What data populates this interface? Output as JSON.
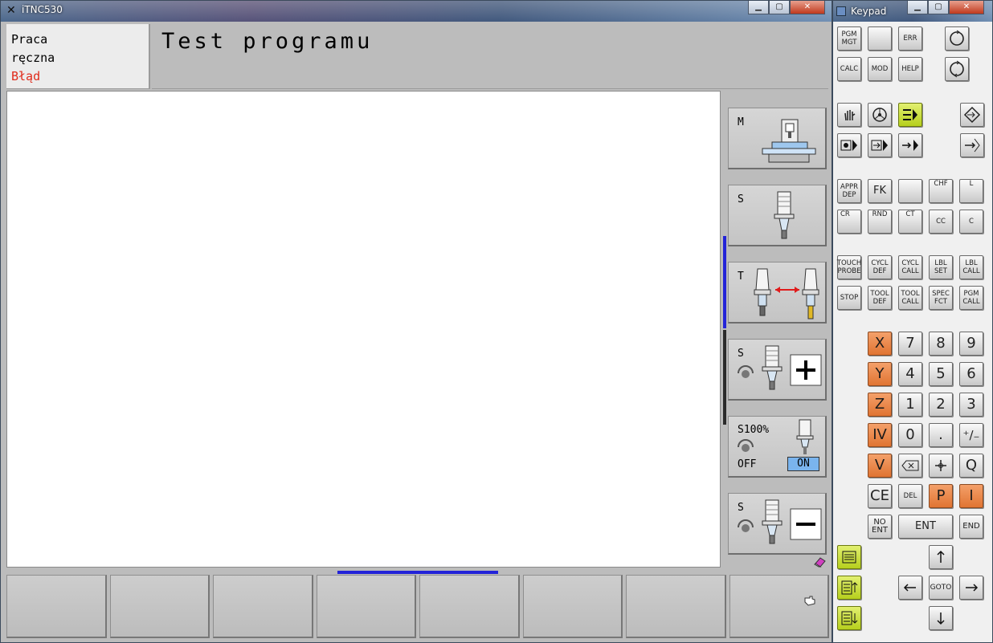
{
  "main_window": {
    "title": "iTNC530",
    "mode_lines": [
      "Praca",
      "ręczna",
      "Błąd"
    ],
    "header_title": "Test programu",
    "vertical_softkeys": {
      "m_label": "M",
      "s_label": "S",
      "t_label": "T",
      "s_plus_label": "S",
      "s100_label": "S100%",
      "off_label": "OFF",
      "on_label": "ON",
      "s_minus_label": "S"
    }
  },
  "keypad_window": {
    "title": "Keypad",
    "keys": {
      "pgm_mgt": "PGM MGT",
      "err": "ERR",
      "calc": "CALC",
      "mod": "MOD",
      "help": "HELP",
      "appr_dep": "APPR DEP",
      "fk": "FK",
      "chf": "CHF",
      "l": "L",
      "cr": "CR",
      "rnd": "RND",
      "ct": "CT",
      "cc": "CC",
      "c": "C",
      "touch_probe": "TOUCH PROBE",
      "cycl_def": "CYCL DEF",
      "cycl_call": "CYCL CALL",
      "lbl_set": "LBL SET",
      "lbl_call": "LBL CALL",
      "stop": "STOP",
      "tool_def": "TOOL DEF",
      "tool_call": "TOOL CALL",
      "spec_fct": "SPEC FCT",
      "pgm_call": "PGM CALL",
      "axis_x": "X",
      "axis_y": "Y",
      "axis_z": "Z",
      "axis_iv": "IV",
      "axis_v": "V",
      "n7": "7",
      "n8": "8",
      "n9": "9",
      "n4": "4",
      "n5": "5",
      "n6": "6",
      "n1": "1",
      "n2": "2",
      "n3": "3",
      "n0": "0",
      "dot": ".",
      "plusminus": "⁺∕₋",
      "q": "Q",
      "ce": "CE",
      "del": "DEL",
      "p": "P",
      "i": "I",
      "no_ent": "NO ENT",
      "ent": "ENT",
      "end": "END",
      "goto": "GOTO"
    }
  }
}
